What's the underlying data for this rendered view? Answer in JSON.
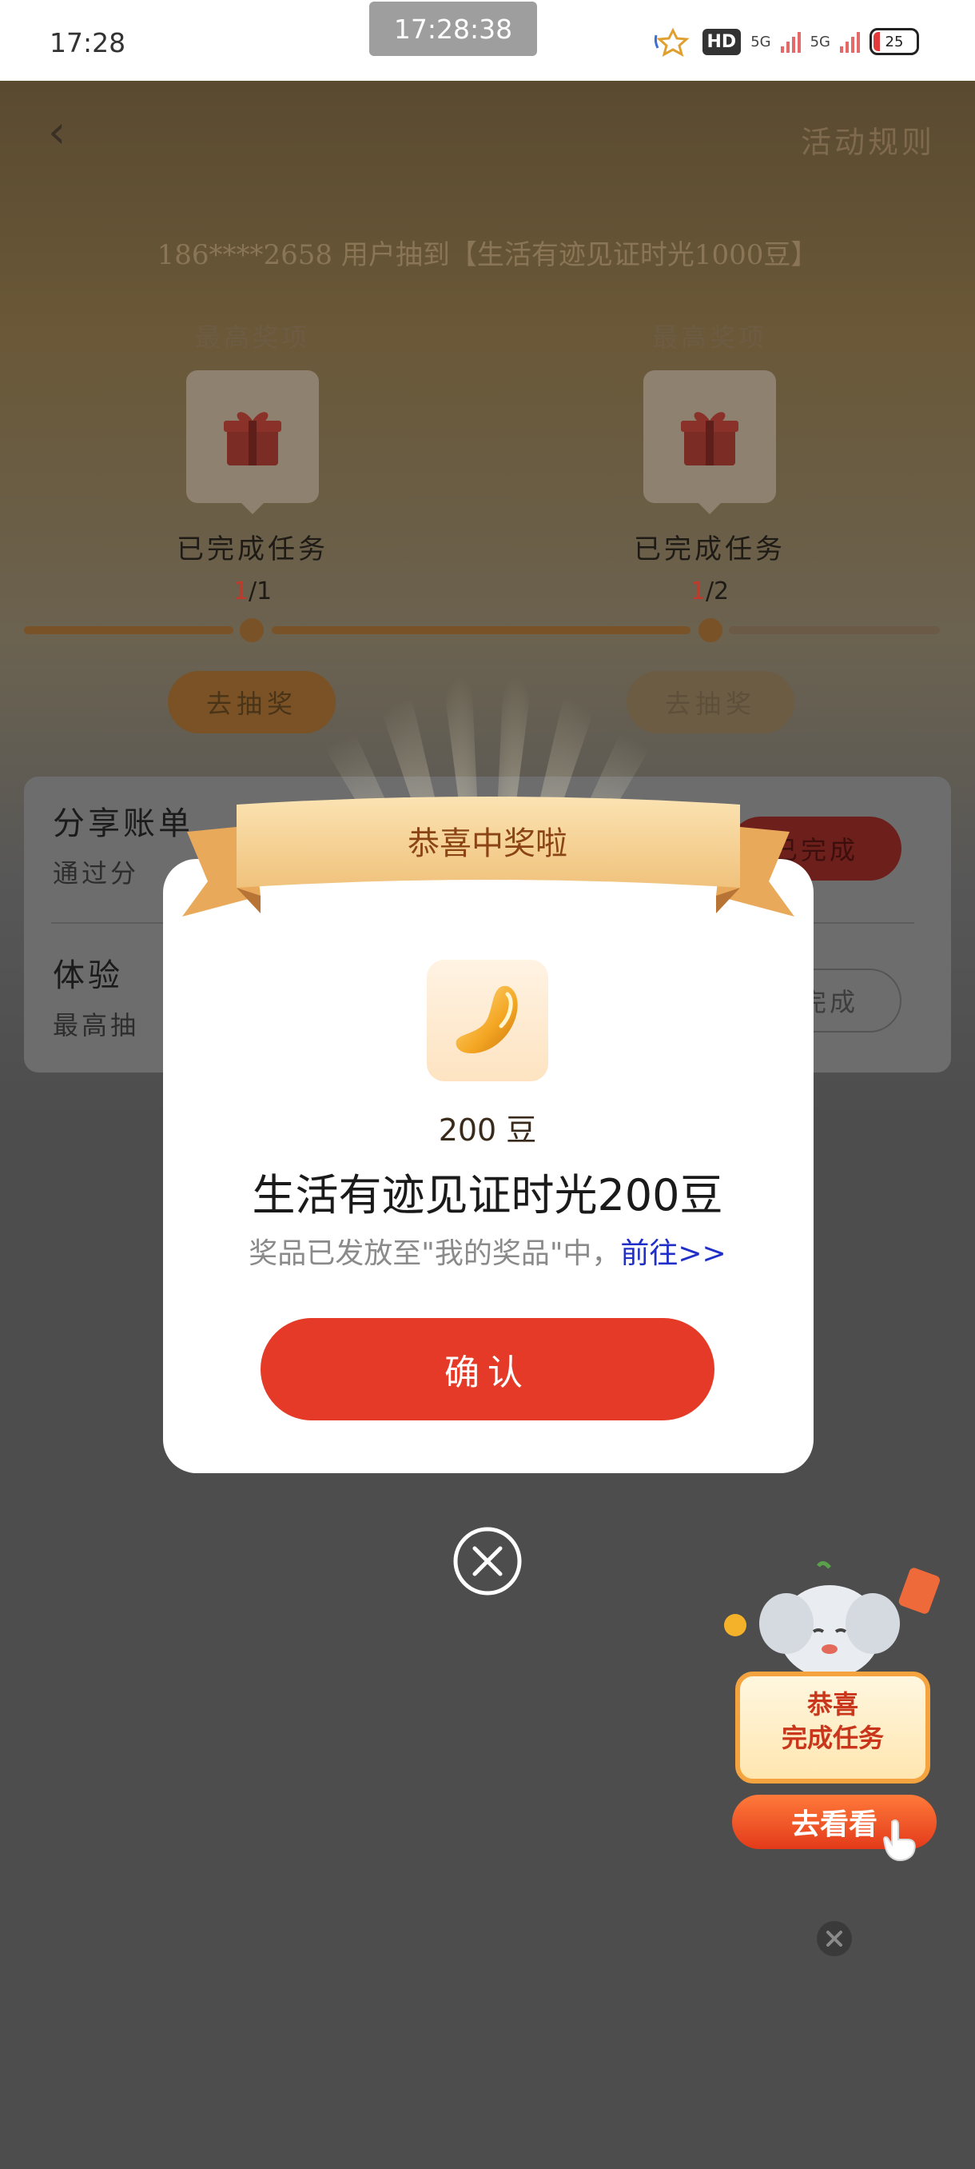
{
  "status_bar": {
    "time": "17:28",
    "recording_time": "17:28:38",
    "hd_label": "HD",
    "signal_label": "5G",
    "battery": "25"
  },
  "header": {
    "rules_link": "活动规则"
  },
  "ticker": "186****2658 用户抽到【生活有迹见证时光1000豆】",
  "milestones": [
    {
      "label": "最高奖项",
      "status": "已完成任务",
      "done": "1",
      "total": "/1",
      "draw_label": "去抽奖"
    },
    {
      "label": "最高奖项",
      "status": "已完成任务",
      "done": "1",
      "total": "/2",
      "draw_label": "去抽奖"
    }
  ],
  "tasks": [
    {
      "title": "分享账单",
      "subtitle": "通过分",
      "button": "已完成"
    },
    {
      "title": "体验",
      "subtitle": "最高抽",
      "button": "去完成"
    }
  ],
  "modal": {
    "banner": "恭喜中奖啦",
    "prize_amount": "200 豆",
    "prize_name": "生活有迹见证时光200豆",
    "note": "奖品已发放至\"我的奖品\"中，",
    "note_link": "前往>>",
    "confirm": "确认"
  },
  "floating_widget": {
    "line1": "恭喜",
    "line2": "完成任务",
    "button": "去看看"
  },
  "colors": {
    "confirm_red": "#e53a27",
    "ribbon_gold": "#f2c27a",
    "link_blue": "#1f2fc8"
  }
}
